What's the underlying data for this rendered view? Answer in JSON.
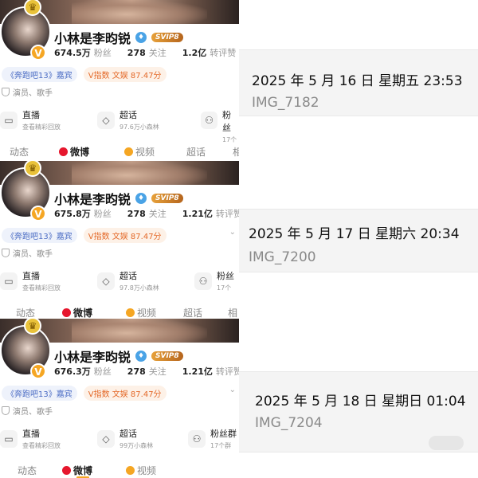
{
  "profile": {
    "name": "小林是李昀锐",
    "svip": "SVIP8",
    "avatar_badge": "♛",
    "verify_mark": "V",
    "fans_label": "粉丝",
    "follow_label": "关注",
    "repost_label": "转评赞",
    "tag_show": "《奔跑吧13》嘉宾",
    "tag_vindex": "V指数 文娱 87.47分",
    "role": "演员、歌手",
    "feature_live_title": "直播",
    "feature_live_sub": "查看精彩回放",
    "feature_chat_title": "超话",
    "feature_fans_title": "粉丝",
    "tabs": {
      "dynamic": "动态",
      "weibo": "微博",
      "video": "视频",
      "chaohua": "超话",
      "album": "相"
    }
  },
  "panels": [
    {
      "fans": "674.5万",
      "follow": "278",
      "repost": "1.2亿",
      "chat_sub": "97.6万小森林",
      "fans_sub": "17个"
    },
    {
      "fans": "675.8万",
      "follow": "278",
      "repost": "1.21亿",
      "chat_sub": "97.8万小森林",
      "fans_sub": "17个"
    },
    {
      "fans": "676.3万",
      "follow": "278",
      "repost": "1.21亿",
      "chat_sub": "99万小森林",
      "fans_title": "粉丝群",
      "fans_sub": "17个群"
    }
  ],
  "screenshots": [
    {
      "date": "2025 年 5 月 16 日  星期五 23:53",
      "file": "IMG_7182"
    },
    {
      "date": "2025 年 5 月 17 日  星期六 20:34",
      "file": "IMG_7200"
    },
    {
      "date": "2025 年 5 月 18 日  星期日 01:04",
      "file": "IMG_7204"
    }
  ],
  "colors": {
    "accent": "#f5a623",
    "link": "#4b6cc4",
    "weibo_red": "#e6162d"
  },
  "icons": {
    "live": "tv-icon",
    "chaohua": "diamond-icon",
    "fans": "people-icon",
    "role": "shield-icon",
    "expand": "chevron-down-icon"
  }
}
